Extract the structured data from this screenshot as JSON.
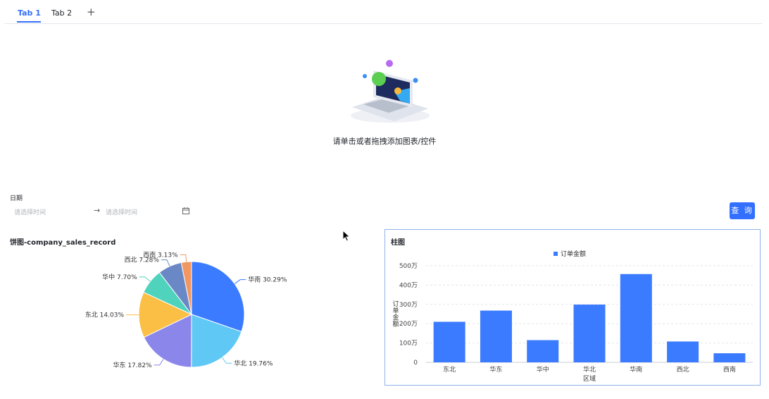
{
  "tabs": [
    {
      "label": "Tab 1",
      "active": true
    },
    {
      "label": "Tab 2",
      "active": false
    }
  ],
  "tab_add_label": "+",
  "empty_state": {
    "text": "请单击或者拖拽添加图表/控件",
    "icon": "laptop-illustration"
  },
  "filter": {
    "label": "日期",
    "start_placeholder": "请选择时间",
    "end_placeholder": "请选择时间",
    "separator": "→",
    "icon": "calendar-icon",
    "query_label": "查 询"
  },
  "colors": {
    "accent": "#3370ff",
    "bar": "#3b7bff"
  },
  "pie_title": "饼图-company_sales_record",
  "bar_title": "柱图",
  "chart_data": [
    {
      "type": "pie",
      "title": "饼图-company_sales_record",
      "slices": [
        {
          "label": "华南",
          "percent_label": "30.29%",
          "value": 30.29,
          "color": "#3b7bff"
        },
        {
          "label": "华北",
          "percent_label": "19.76%",
          "value": 19.76,
          "color": "#5fc8f5"
        },
        {
          "label": "华东",
          "percent_label": "17.82%",
          "value": 17.82,
          "color": "#8b86ea"
        },
        {
          "label": "东北",
          "percent_label": "14.03%",
          "value": 14.03,
          "color": "#fbbf45"
        },
        {
          "label": "华中",
          "percent_label": "7.70%",
          "value": 7.7,
          "color": "#4fd3bd"
        },
        {
          "label": "西北",
          "percent_label": "7.28%",
          "value": 7.28,
          "color": "#6b88c6"
        },
        {
          "label": "西南",
          "percent_label": "3.13%",
          "value": 3.13,
          "color": "#f09762"
        }
      ]
    },
    {
      "type": "bar",
      "title": "柱图",
      "categories": [
        "东北",
        "华东",
        "华中",
        "华北",
        "华南",
        "西北",
        "西南"
      ],
      "series": [
        {
          "name": "订单金额",
          "values": [
            2100000,
            2680000,
            1150000,
            2990000,
            4570000,
            1080000,
            470000
          ]
        }
      ],
      "xlabel": "区域",
      "ylabel": "订单金额",
      "yticks": [
        "0",
        "100万",
        "200万",
        "300万",
        "400万",
        "500万"
      ],
      "ylim": [
        0,
        5000000
      ],
      "grid": true,
      "legend": "top-center"
    }
  ]
}
